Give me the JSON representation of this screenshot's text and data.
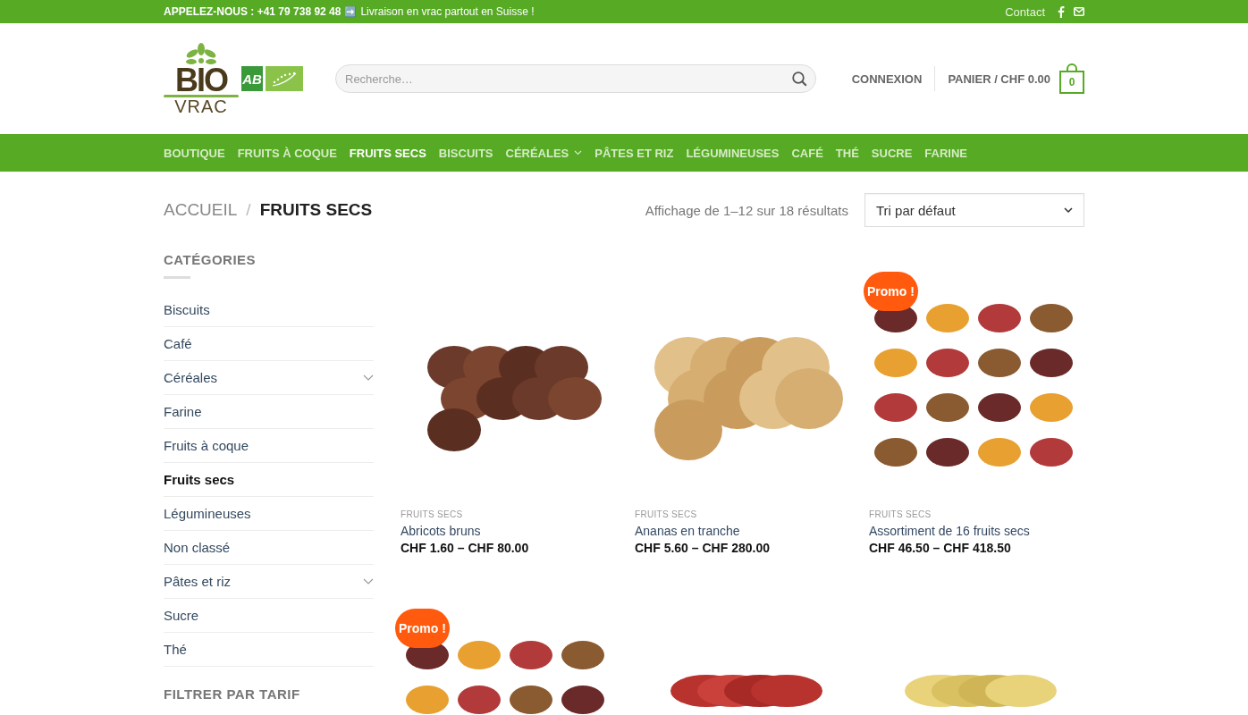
{
  "top_bar": {
    "phone": "APPELEZ-NOUS : +41 79 738 92 48",
    "arrow": "➡️",
    "message": "Livraison en vrac partout en Suisse !",
    "contact": "Contact"
  },
  "header": {
    "logo_word": "BIO",
    "logo_sub": "VRAC",
    "badge": "AB",
    "search": {
      "placeholder": "Recherche…"
    },
    "login": "CONNEXION",
    "cart": "PANIER / CHF 0.00",
    "cart_count": "0"
  },
  "nav": [
    {
      "label": "BOUTIQUE",
      "selected": false,
      "dropdown": false
    },
    {
      "label": "FRUITS À COQUE",
      "selected": false,
      "dropdown": false
    },
    {
      "label": "FRUITS SECS",
      "selected": true,
      "dropdown": false
    },
    {
      "label": "BISCUITS",
      "selected": false,
      "dropdown": false
    },
    {
      "label": "CÉRÉALES",
      "selected": false,
      "dropdown": true
    },
    {
      "label": "PÂTES ET RIZ",
      "selected": false,
      "dropdown": false
    },
    {
      "label": "LÉGUMINEUSES",
      "selected": false,
      "dropdown": false
    },
    {
      "label": "CAFÉ",
      "selected": false,
      "dropdown": false
    },
    {
      "label": "THÉ",
      "selected": false,
      "dropdown": false
    },
    {
      "label": "SUCRE",
      "selected": false,
      "dropdown": false
    },
    {
      "label": "FARINE",
      "selected": false,
      "dropdown": false
    }
  ],
  "breadcrumb": {
    "home": "ACCUEIL",
    "separator": "/",
    "current": "FRUITS SECS"
  },
  "result_count": "Affichage de 1–12 sur 18 résultats",
  "sort": {
    "value": "Tri par défaut"
  },
  "sidebar": {
    "title": "CATÉGORIES",
    "categories": [
      {
        "label": "Biscuits",
        "selected": false,
        "expandable": false
      },
      {
        "label": "Café",
        "selected": false,
        "expandable": false
      },
      {
        "label": "Céréales",
        "selected": false,
        "expandable": true
      },
      {
        "label": "Farine",
        "selected": false,
        "expandable": false
      },
      {
        "label": "Fruits à coque",
        "selected": false,
        "expandable": false
      },
      {
        "label": "Fruits secs",
        "selected": true,
        "expandable": false
      },
      {
        "label": "Légumineuses",
        "selected": false,
        "expandable": false
      },
      {
        "label": "Non classé",
        "selected": false,
        "expandable": false
      },
      {
        "label": "Pâtes et riz",
        "selected": false,
        "expandable": true
      },
      {
        "label": "Sucre",
        "selected": false,
        "expandable": false
      },
      {
        "label": "Thé",
        "selected": false,
        "expandable": false
      }
    ],
    "filter_title": "FILTRER PAR TARIF"
  },
  "products": [
    {
      "kind": "apricots",
      "category": "FRUITS SECS",
      "name": "Abricots bruns",
      "price": "CHF 1.60 – CHF 80.00"
    },
    {
      "kind": "pineapple",
      "category": "FRUITS SECS",
      "name": "Ananas en tranche",
      "price": "CHF 5.60 – CHF 280.00"
    },
    {
      "kind": "assortment",
      "badge": "Promo !",
      "category": "FRUITS SECS",
      "name": "Assortiment de 16 fruits secs",
      "price": "CHF 46.50 – CHF 418.50"
    },
    {
      "kind": "assortment",
      "badge": "Promo !"
    },
    {
      "kind": "goji"
    },
    {
      "kind": "banana"
    }
  ]
}
